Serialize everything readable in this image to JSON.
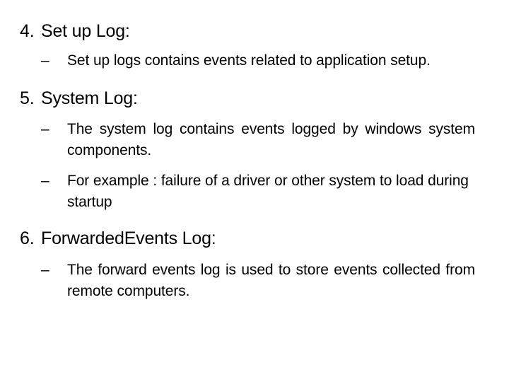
{
  "slide": {
    "background_color": "#ffffff",
    "text_color": "#000000",
    "blocks": [
      {
        "number": "4.",
        "heading": "Set up Log:",
        "bullets": [
          {
            "marker": "–",
            "text": "Set up logs contains events related to application setup.",
            "justified": false
          }
        ]
      },
      {
        "number": "5.",
        "heading": "System Log:",
        "bullets": [
          {
            "marker": "–",
            "text": "The system log contains events logged by windows system components.",
            "justified": true
          },
          {
            "marker": "–",
            "text": "For example : failure of a driver or other system to load during startup",
            "justified": false
          }
        ]
      },
      {
        "number": "6.",
        "heading": "ForwardedEvents Log:",
        "bullets": [
          {
            "marker": "–",
            "text": "The forward events log is used to store events collected from remote computers.",
            "justified": true
          }
        ]
      }
    ]
  }
}
